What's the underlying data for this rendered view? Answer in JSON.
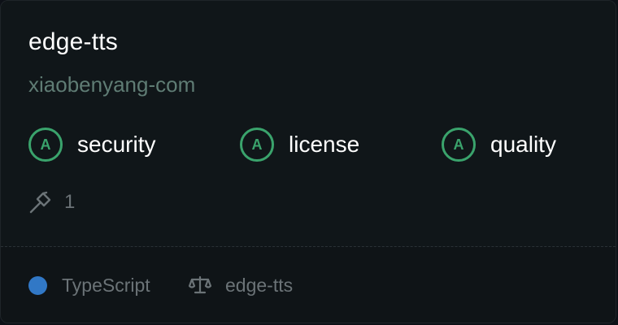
{
  "card": {
    "title": "edge-tts",
    "owner": "xiaobenyang-com",
    "scores": [
      {
        "grade": "A",
        "label": "security"
      },
      {
        "grade": "A",
        "label": "license"
      },
      {
        "grade": "A",
        "label": "quality"
      }
    ],
    "tools_count": "1",
    "language": "TypeScript",
    "license": "edge-tts"
  },
  "colors": {
    "background": "#101619",
    "grade_green": "#3aa36c",
    "owner_text": "#5f7c74",
    "muted_text": "#6b7377",
    "typescript_dot": "#3178c6"
  },
  "icons": {
    "tools": "hammer-icon",
    "license": "scale-icon"
  }
}
